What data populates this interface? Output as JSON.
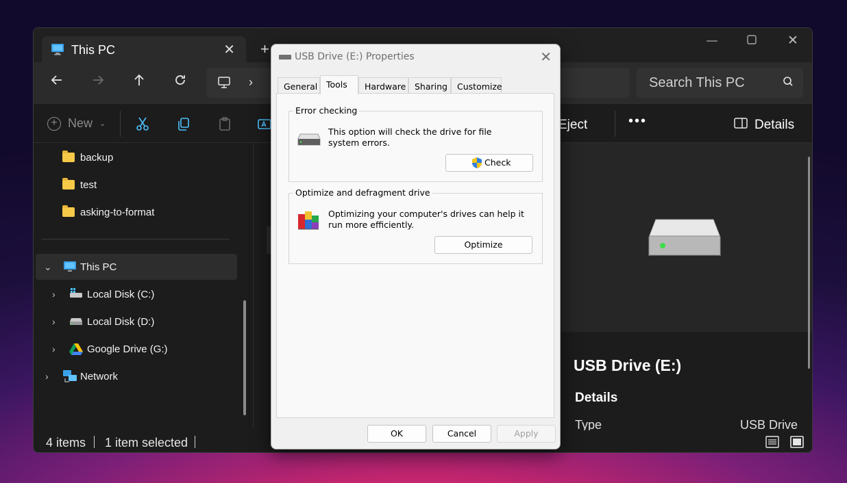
{
  "explorer": {
    "tab_title": "This PC",
    "new_tab_symbol": "+",
    "search_placeholder": "Search This PC",
    "toolbar": {
      "new_label": "New",
      "eject_label": "Eject",
      "more_label": "•••",
      "details_label": "Details"
    },
    "sidebar": {
      "folders": [
        {
          "label": "backup",
          "icon": "folder-icon"
        },
        {
          "label": "test",
          "icon": "folder-icon"
        },
        {
          "label": "asking-to-format",
          "icon": "folder-icon"
        }
      ],
      "this_pc_label": "This PC",
      "drives": [
        {
          "label": "Local Disk (C:)",
          "icon": "windows-drive-icon"
        },
        {
          "label": "Local Disk (D:)",
          "icon": "drive-icon"
        },
        {
          "label": "Google Drive (G:)",
          "icon": "google-drive-icon"
        }
      ],
      "network_label": "Network"
    },
    "status": {
      "item_count": "4 items",
      "selection": "1 item selected"
    },
    "details_pane": {
      "name": "USB Drive (E:)",
      "heading": "Details",
      "type_key": "Type",
      "type_value": "USB Drive"
    }
  },
  "dialog": {
    "title": "USB Drive (E:) Properties",
    "tabs": [
      "General",
      "Tools",
      "Hardware",
      "Sharing",
      "Customize"
    ],
    "active_tab": "Tools",
    "error_checking": {
      "title": "Error checking",
      "description": "This option will check the drive for file system errors.",
      "button": "Check"
    },
    "optimize": {
      "title": "Optimize and defragment drive",
      "description": "Optimizing your computer's drives can help it run more efficiently.",
      "button": "Optimize"
    },
    "buttons": {
      "ok": "OK",
      "cancel": "Cancel",
      "apply": "Apply"
    }
  },
  "colors": {
    "accent": "#4cc2ff",
    "explorer_bg": "#1c1c1c",
    "dialog_bg": "#f0f0f0",
    "drive_led": "#3ddc4a"
  }
}
